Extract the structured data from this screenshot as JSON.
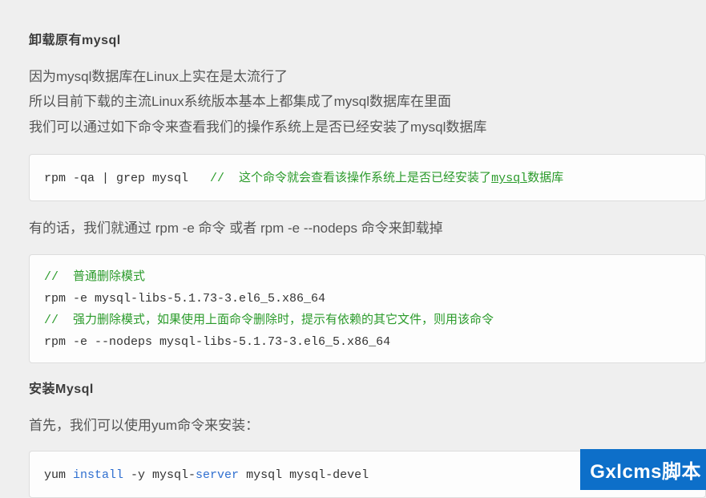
{
  "sections": {
    "uninstall": {
      "heading": "卸载原有mysql",
      "paragraphs": [
        "因为mysql数据库在Linux上实在是太流行了",
        "所以目前下载的主流Linux系统版本基本上都集成了mysql数据库在里面",
        "我们可以通过如下命令来查看我们的操作系统上是否已经安装了mysql数据库"
      ],
      "code1_cmd": "rpm -qa | grep mysql   ",
      "code1_comment_prefix": "//  这个命令就会查看该操作系统上是否已经安装了",
      "code1_comment_mysql": "mysql",
      "code1_comment_suffix": "数据库",
      "after_code1": "有的话，我们就通过 rpm -e 命令 或者 rpm -e --nodeps 命令来卸载掉",
      "code2_comment1": "//  普通删除模式",
      "code2_line1": "rpm -e mysql-libs-5.1.73-3.el6_5.x86_64",
      "code2_comment2": "//  强力删除模式，如果使用上面命令删除时，提示有依赖的其它文件，则用该命令",
      "code2_line2": "rpm -e --nodeps mysql-libs-5.1.73-3.el6_5.x86_64"
    },
    "install": {
      "heading": "安装Mysql",
      "paragraph": "首先，我们可以使用yum命令来安装：",
      "code_prefix": "yum ",
      "code_kw1": "install",
      "code_mid": " -y mysql-",
      "code_kw2": "server",
      "code_suffix": " mysql mysql-devel"
    }
  },
  "watermark": "Gxlcms脚本"
}
